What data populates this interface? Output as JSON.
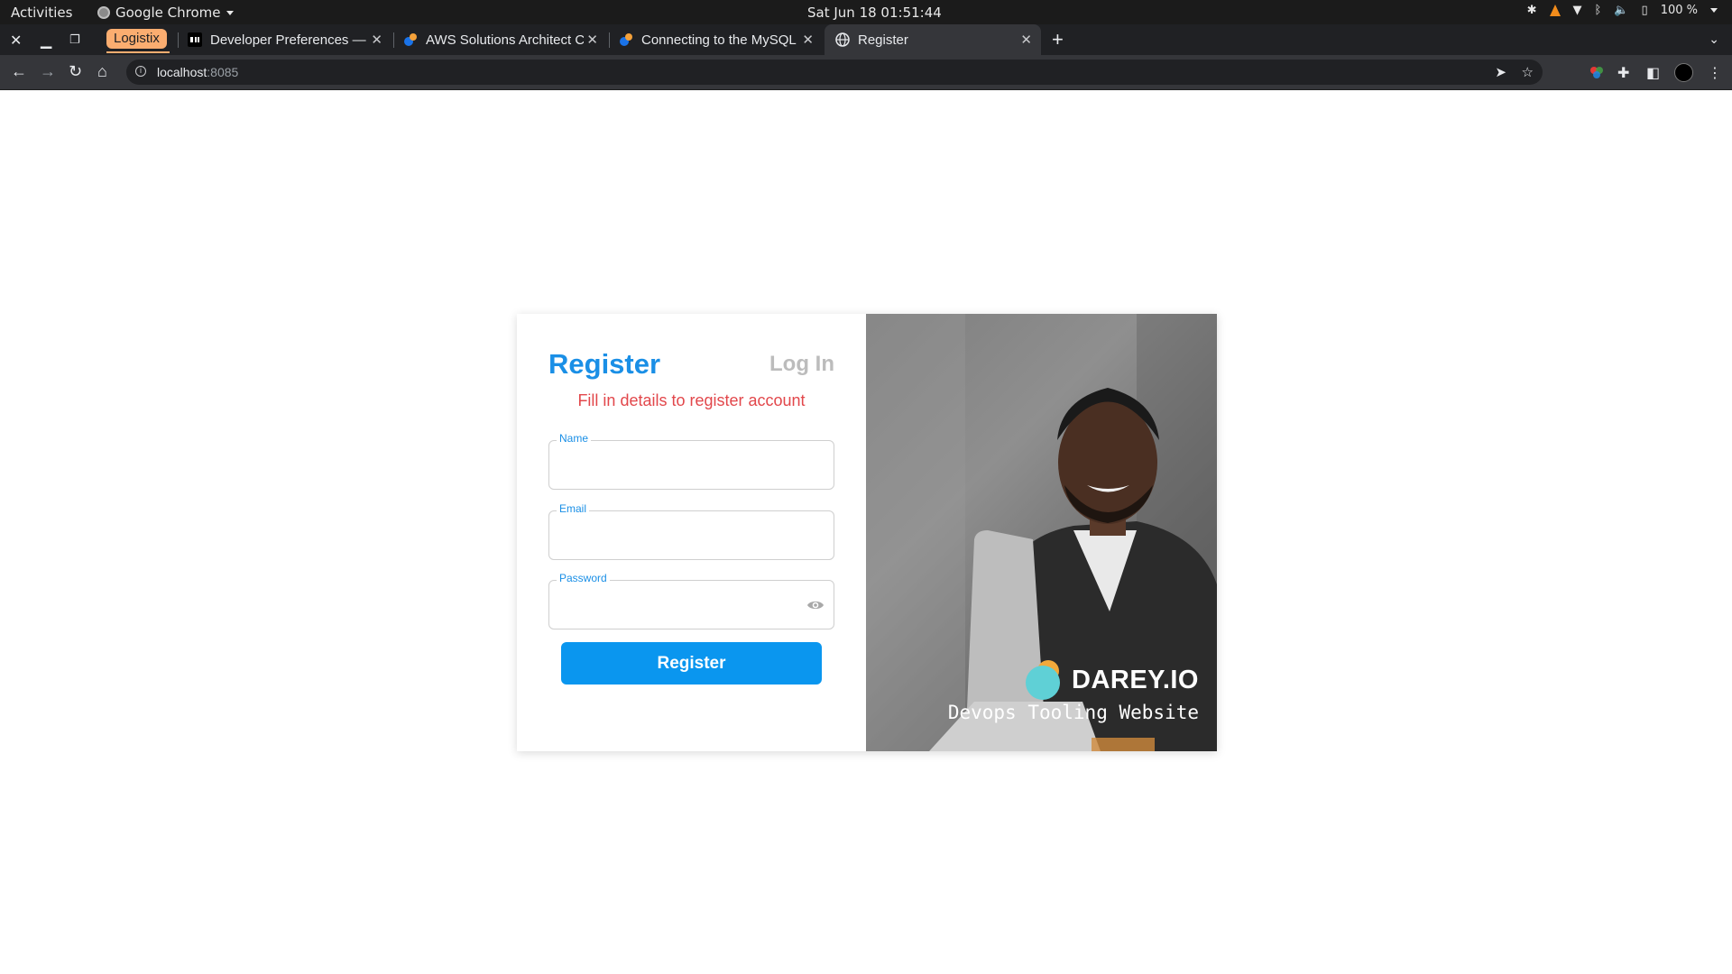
{
  "system": {
    "activities": "Activities",
    "app_name": "Google Chrome",
    "clock": "Sat Jun 18  01:51:44",
    "battery": "100 %"
  },
  "tabs": {
    "group_label": "Logistix",
    "items": [
      {
        "title": "Developer Preferences —",
        "active": false
      },
      {
        "title": "AWS Solutions Architect C",
        "active": false
      },
      {
        "title": "Connecting to the MySQL",
        "active": false
      },
      {
        "title": "Register",
        "active": true
      }
    ]
  },
  "address_bar": {
    "host": "localhost",
    "port": ":8085"
  },
  "page": {
    "register_title": "Register",
    "login_link": "Log In",
    "subtitle": "Fill in details to register account",
    "fields": {
      "name_label": "Name",
      "email_label": "Email",
      "password_label": "Password"
    },
    "register_button": "Register",
    "brand_name": "DAREY.IO",
    "tagline": "Devops Tooling Website"
  },
  "colors": {
    "accent": "#1a8fe6",
    "button": "#0a96ef",
    "subtitle_red": "#e2474b",
    "tab_group": "#fbad70"
  }
}
